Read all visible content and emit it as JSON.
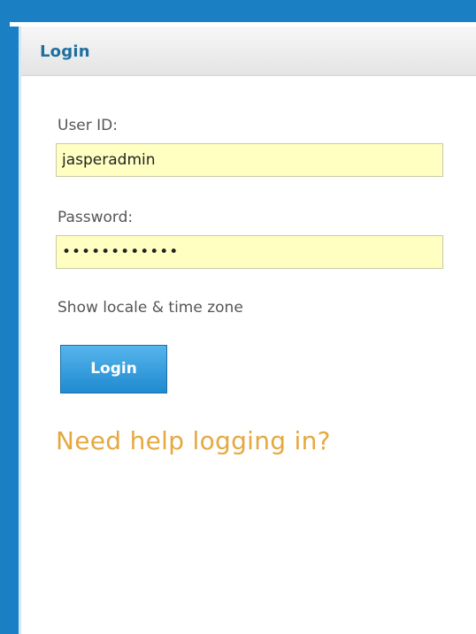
{
  "panel": {
    "title": "Login"
  },
  "form": {
    "userid_label": "User ID:",
    "userid_value": "jasperadmin",
    "password_label": "Password:",
    "password_value": "••••••••••••",
    "locale_link": "Show locale & time zone",
    "login_button": "Login",
    "help_link": "Need help logging in?"
  },
  "colors": {
    "brand_blue": "#1b7fc4",
    "title_blue": "#1d6f9f",
    "input_bg": "#ffffc2",
    "help_orange": "#e5a840"
  }
}
